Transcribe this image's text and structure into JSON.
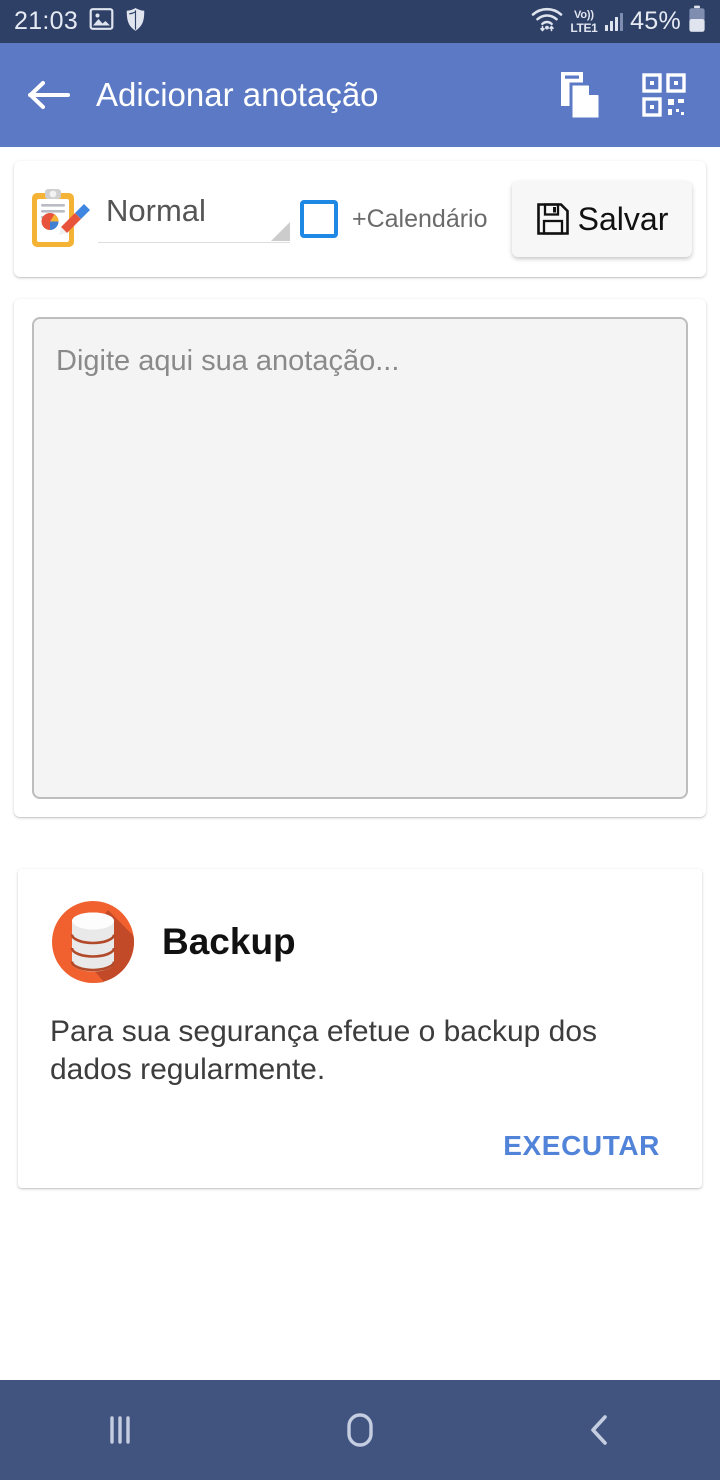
{
  "status_bar": {
    "time": "21:03",
    "network_label_top": "Vo))",
    "network_label_bottom": "LTE1",
    "battery_percent": "45%",
    "icons": [
      "image-icon",
      "shield-icon",
      "wifi-icon",
      "volte-icon",
      "signal-bars-icon",
      "battery-icon"
    ],
    "background_color": "#2e4066",
    "text_color": "#e6eaf3"
  },
  "app_bar": {
    "title": "Adicionar anotação",
    "back_icon": "arrow-left-icon",
    "action_icons": [
      "copy-documents-icon",
      "qr-code-icon"
    ],
    "background_color": "#5b79c4",
    "title_color": "#ffffff"
  },
  "toolbar": {
    "type_icon": "clipboard-chart-pencil-icon",
    "spinner_value": "Normal",
    "calendar_checkbox_label": "+Calendário",
    "calendar_checkbox_checked": false,
    "checkbox_color": "#1e88e5",
    "save_label": "Salvar",
    "save_icon": "floppy-disk-icon"
  },
  "note": {
    "value": "",
    "placeholder": "Digite aqui sua anotação..."
  },
  "backup_card": {
    "icon": "database-icon",
    "title": "Backup",
    "description": "Para sua segurança efetue o backup dos dados regularmente.",
    "action_label": "EXECUTAR",
    "action_color": "#5183d8",
    "icon_color": "#f0612f"
  },
  "nav_bar": {
    "items": [
      "recents-icon",
      "home-icon",
      "back-icon"
    ],
    "background_color": "#415480"
  }
}
